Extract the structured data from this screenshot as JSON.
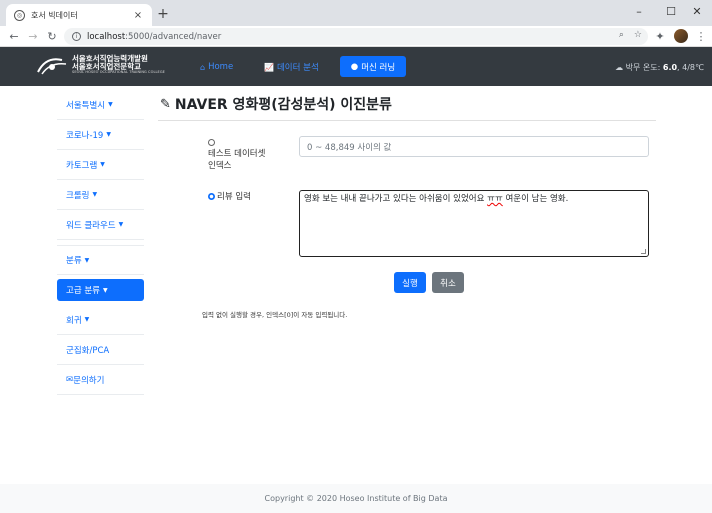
{
  "browser": {
    "tab_title": "호서 빅데이터",
    "tab_close": "×",
    "new_tab": "+",
    "window_controls": [
      "–",
      "☐",
      "✕"
    ],
    "url_host": "localhost",
    "url_path": ":5000/advanced/naver",
    "nav_icons": [
      "back-icon",
      "forward-icon",
      "reload-icon"
    ]
  },
  "navbar": {
    "logo_line1": "서울호서직업능력개발원",
    "logo_line2": "서울호서직업전문학교",
    "logo_line3": "SEOUL HOSEO OCCUPATIONAL TRAINING COLLEGE",
    "links": [
      {
        "label": "Home",
        "icon": "home-icon"
      },
      {
        "label": "데이터 분석",
        "icon": "chart-icon"
      },
      {
        "label": "머신 러닝",
        "icon": "brain-icon"
      }
    ],
    "weather_label": "박무 온도: ",
    "weather_temp": "6.0",
    "weather_range": ", 4/8℃"
  },
  "sidebar": {
    "items": [
      {
        "label": "서울특별시",
        "caret": true
      },
      {
        "label": "코로나-19",
        "caret": true
      },
      {
        "label": "카토그램",
        "caret": true
      },
      {
        "label": "크롤링",
        "caret": true
      },
      {
        "label": "워드 클라우드",
        "caret": true
      },
      {
        "label": "분류",
        "caret": true
      },
      {
        "label": "고급 분류",
        "caret": true
      },
      {
        "label": "회귀",
        "caret": true
      },
      {
        "label": "군집화/PCA",
        "caret": false
      },
      {
        "label": "문의하기",
        "caret": false
      }
    ]
  },
  "main": {
    "title": "NAVER 영화평(감성분석) 이진분류",
    "test_index_label_1": "테스트 데이터셋",
    "test_index_label_2": "인덱스",
    "test_index_placeholder": "0 ~ 48,849 사이의 값",
    "review_label": "리뷰 입력",
    "review_text_before": "영화 보는 내내 끝나가고 있다는 아쉬움이 있었어요 ",
    "review_text_typo": "ㅠㅠ",
    "review_text_after": " 여운이 남는 영화.",
    "run_button": "실행",
    "cancel_button": "취소",
    "hint": "입력 없이 실행할 경우, 인덱스[0]이 자동 입력됩니다."
  },
  "footer": {
    "copyright": "Copyright © 2020 Hoseo Institute of Big Data"
  },
  "colors": {
    "primary": "#0d6efd",
    "navbar": "#343a40",
    "secondary": "#6c757d"
  }
}
